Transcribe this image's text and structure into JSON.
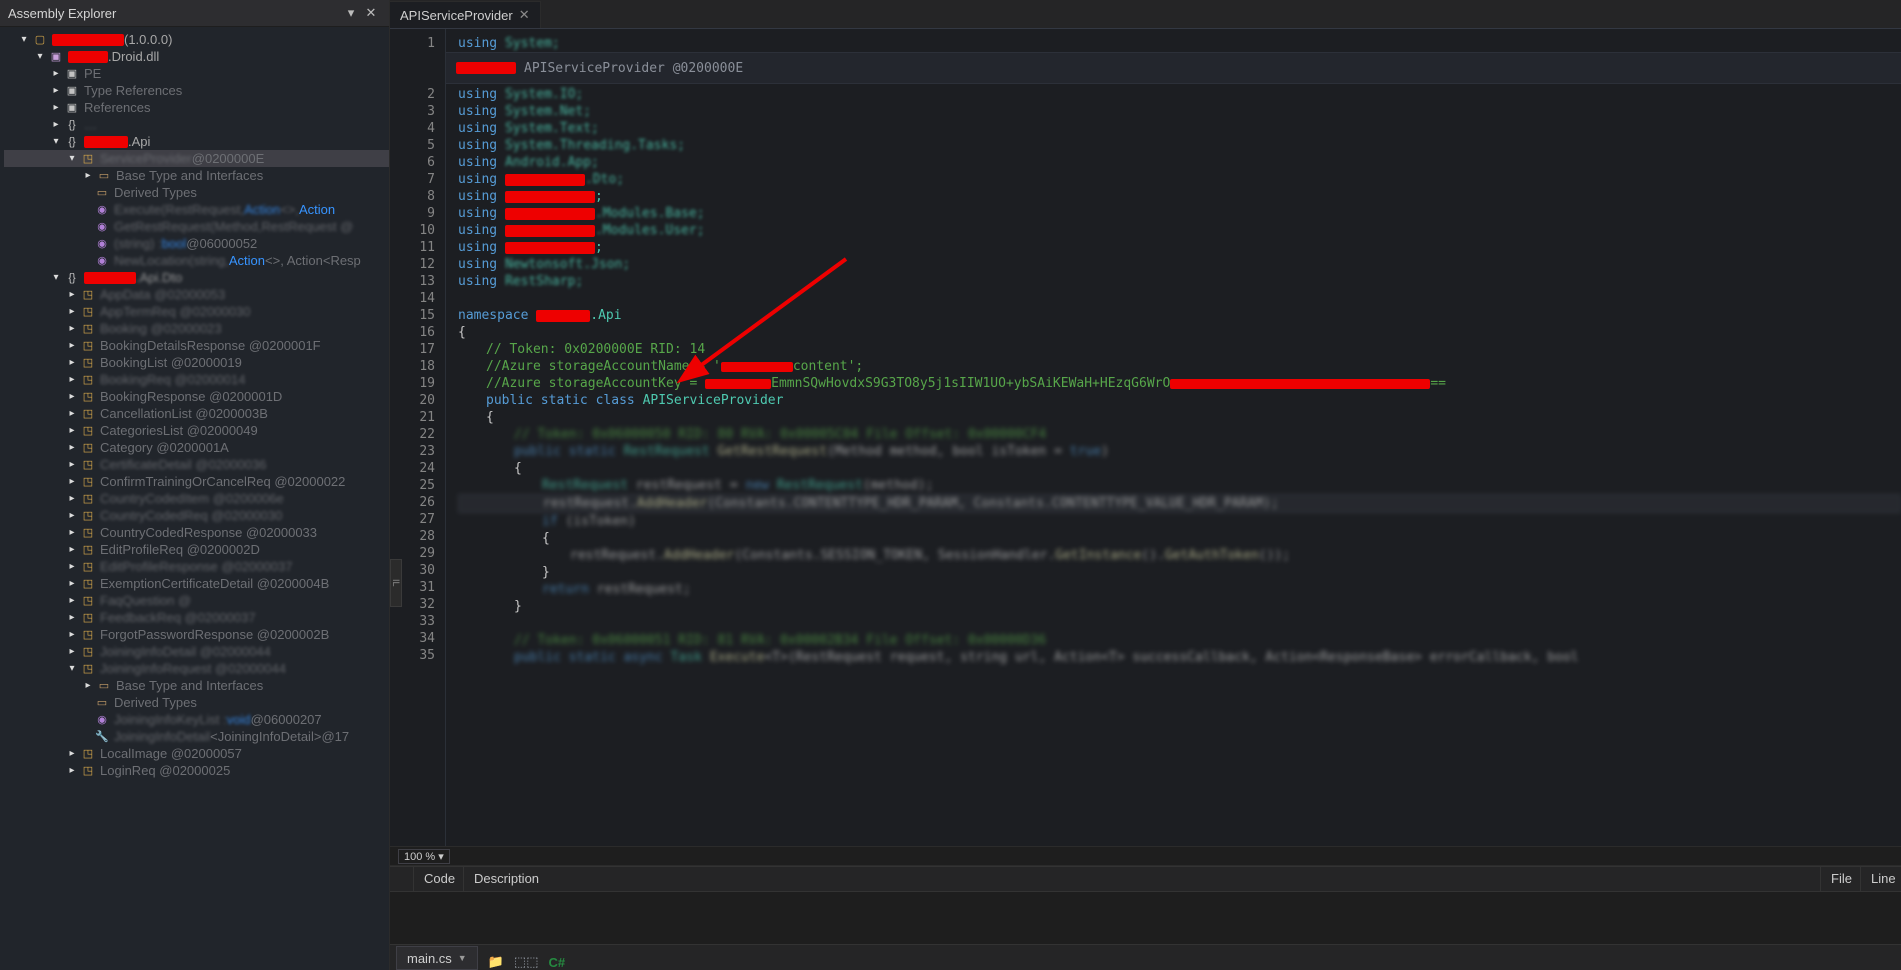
{
  "explorer": {
    "title": "Assembly Explorer",
    "root_version": "(1.0.0.0)",
    "module_suffix": ".Droid.dll",
    "nodes_pe": "PE",
    "nodes_typerefs": "Type References",
    "nodes_refs": "References",
    "ns_api_suffix": ".Api",
    "sel_provider": "ServiceProvider",
    "sel_provider_token": " @0200000E",
    "sub_btai": "Base Type and Interfaces",
    "sub_derived": "Derived Types",
    "sub_exec_a": "Execute(RestRequest, ",
    "sub_exec_b": "Action",
    "sub_exec_c": "<>, ",
    "sub_exec_d": "Action",
    "sub_gr": "GetRestRequest(Method, ",
    "sub_gr_b": "RestRequest @",
    "sub_login_a": "(string) : ",
    "sub_login_b": "bool",
    "sub_login_c": " @06000052",
    "sub_newloc_a": "NewLocation(string, ",
    "sub_newloc_b": "Action",
    "sub_newloc_c": "<>, Action<Resp",
    "ns2_suffix": ".Api.Dto",
    "items": {
      "appdata": "AppData @02000053",
      "apptermreq": "AppTermReq @02000030",
      "booking": "Booking @02000023",
      "bookingdetails": "BookingDetailsResponse @0200001F",
      "bookinglist": "BookingList @02000019",
      "bookingreq": "BookingReq @02000014",
      "bookingresponse": "BookingResponse @0200001D",
      "cancellationlist": "CancellationList @0200003B",
      "categorieslist": "CategoriesList @02000049",
      "category": "Category @0200001A",
      "certdetail": "CertificateDetail @02000036",
      "confirmtraining": "ConfirmTrainingOrCancelReq @02000022",
      "countrycodeditem": "CountryCodedItem @0200006e",
      "countrycodedreq": "CountryCodedReq @02000030",
      "countrycodedresponse": "CountryCodedResponse @02000033",
      "editprofilereq": "EditProfileReq @0200002D",
      "editprofileresponse": "EditProfileResponse @02000037",
      "exemptioncert": "ExemptionCertificateDetail @0200004B",
      "faqquestion": "FaqQuestion @",
      "feedbackreq": "FeedbackReq @02000037",
      "forgotpasswordresponse": "ForgotPasswordResponse @0200002B",
      "joininginfo": "JoiningInfoDetail @02000044",
      "joininginforeq": "JoiningInfoRequest @02000044",
      "jir_btai": "Base Type and Interfaces",
      "jir_derived": "Derived Types",
      "jir_keylist_a": "JoiningInfoKeyList : ",
      "jir_keylist_b": "void",
      "jir_keylist_c": " @06000207",
      "jir_detail_a": "JoiningInfoDetail ",
      "jir_detail_b": "<JoiningInfoDetail>",
      "jir_detail_c": " @17",
      "localimage": "LocalImage @02000057",
      "loginreq": "LoginReq @02000025"
    }
  },
  "tab": {
    "title": "APIServiceProvider"
  },
  "breadcrumb": {
    "text": "APIServiceProvider @0200000E"
  },
  "code_lines": {
    "l1": {
      "a": "using",
      "b": "System;"
    },
    "l2": {
      "a": "using",
      "b": "System.IO;"
    },
    "l3": {
      "a": "using",
      "b": "System.Net;"
    },
    "l4": {
      "a": "using",
      "b": "System.Text;"
    },
    "l5": {
      "a": "using",
      "b": "System.Threading.Tasks;"
    },
    "l6": {
      "a": "using",
      "b": "Android.App;"
    },
    "l7": {
      "a": "using",
      "c": ".Dto;"
    },
    "l8": {
      "a": "using",
      "c": ";"
    },
    "l9": {
      "a": "using",
      "c": ".Modules.Base;"
    },
    "l10": {
      "a": "using",
      "c": ".Modules.User;"
    },
    "l11": {
      "a": "using",
      "c": ";"
    },
    "l12": {
      "a": "using",
      "b": "Newtonsoft.Json;"
    },
    "l13": {
      "a": "using",
      "b": "RestSharp;"
    },
    "l15": {
      "a": "namespace",
      "c": ".Api"
    },
    "l16": {
      "a": "{"
    },
    "l17": {
      "a": "// Token: 0x0200000E RID: 14"
    },
    "l18": {
      "a": "//Azure storageAccountName = '",
      "b": "content';"
    },
    "l19": {
      "a": "//Azure storageAccountKey = ",
      "b": "EmmnSQwHovdxS9G3TO8y5j1sIIW1UO+ybSAiKEWaH+HEzqG6WrO",
      "c": "=="
    },
    "l20": {
      "a": "public",
      "b": "static",
      "c": "class",
      "d": "APIServiceProvider"
    },
    "l21": {
      "a": "{"
    },
    "l22": {
      "a": "// Token: 0x06000050 RID: 80 RVA: 0x00005C04 File Offset: 0x00000CF4"
    },
    "l23": {
      "a": "public static",
      "b": "RestRequest",
      "c": "GetRestRequest",
      "d": "(Method ",
      "e": "method",
      "f": ", bool ",
      "g": "isToken",
      "h": " = ",
      "i": "true",
      "j": ")"
    },
    "l24": {
      "a": "{"
    },
    "l25": {
      "a": "RestRequest",
      "b": " restRequest = ",
      "c": "new ",
      "d": "RestRequest",
      "e": "(method);"
    },
    "l26": {
      "a": "restRequest.",
      "b": "AddHeader",
      "c": "(Constants.CONTENTTYPE_HDR_PARAM, Constants.CONTENTTYPE_VALUE_HDR_PARAM);"
    },
    "l27": {
      "a": "if",
      "b": " (isToken)"
    },
    "l28": {
      "a": "{"
    },
    "l29": {
      "a": "restRequest.",
      "b": "AddHeader",
      "c": "(Constants.",
      "d": "SESSION_TOKEN",
      "e": ", SessionHandler.",
      "f": "GetInstance",
      "g": "().",
      "h": "GetAuthToken",
      "i": "());"
    },
    "l30": {
      "a": "}"
    },
    "l31": {
      "a": "return",
      "b": " restRequest;"
    },
    "l32": {
      "a": "}"
    },
    "l34": {
      "a": "// Token: 0x06000051 RID: 81 RVA: 0x00002B34 File Offset: 0x00000D36"
    },
    "l35": {
      "a": "public static async",
      "b": "Task",
      "c": "Execute",
      "d": "<T>(RestRequest ",
      "e": "request",
      "f": ", string ",
      "g": "url",
      "h": ", Action<T> ",
      "i": "successCallback",
      "j": ", Action<ResponseBase> ",
      "k": "errorCallback",
      "l": ", bool"
    }
  },
  "zoom": {
    "value": "100 %"
  },
  "findings": {
    "code": "Code",
    "desc": "Description",
    "file": "File",
    "line": "Line"
  },
  "bottom": {
    "tab": "main.cs",
    "cs": "C#"
  }
}
